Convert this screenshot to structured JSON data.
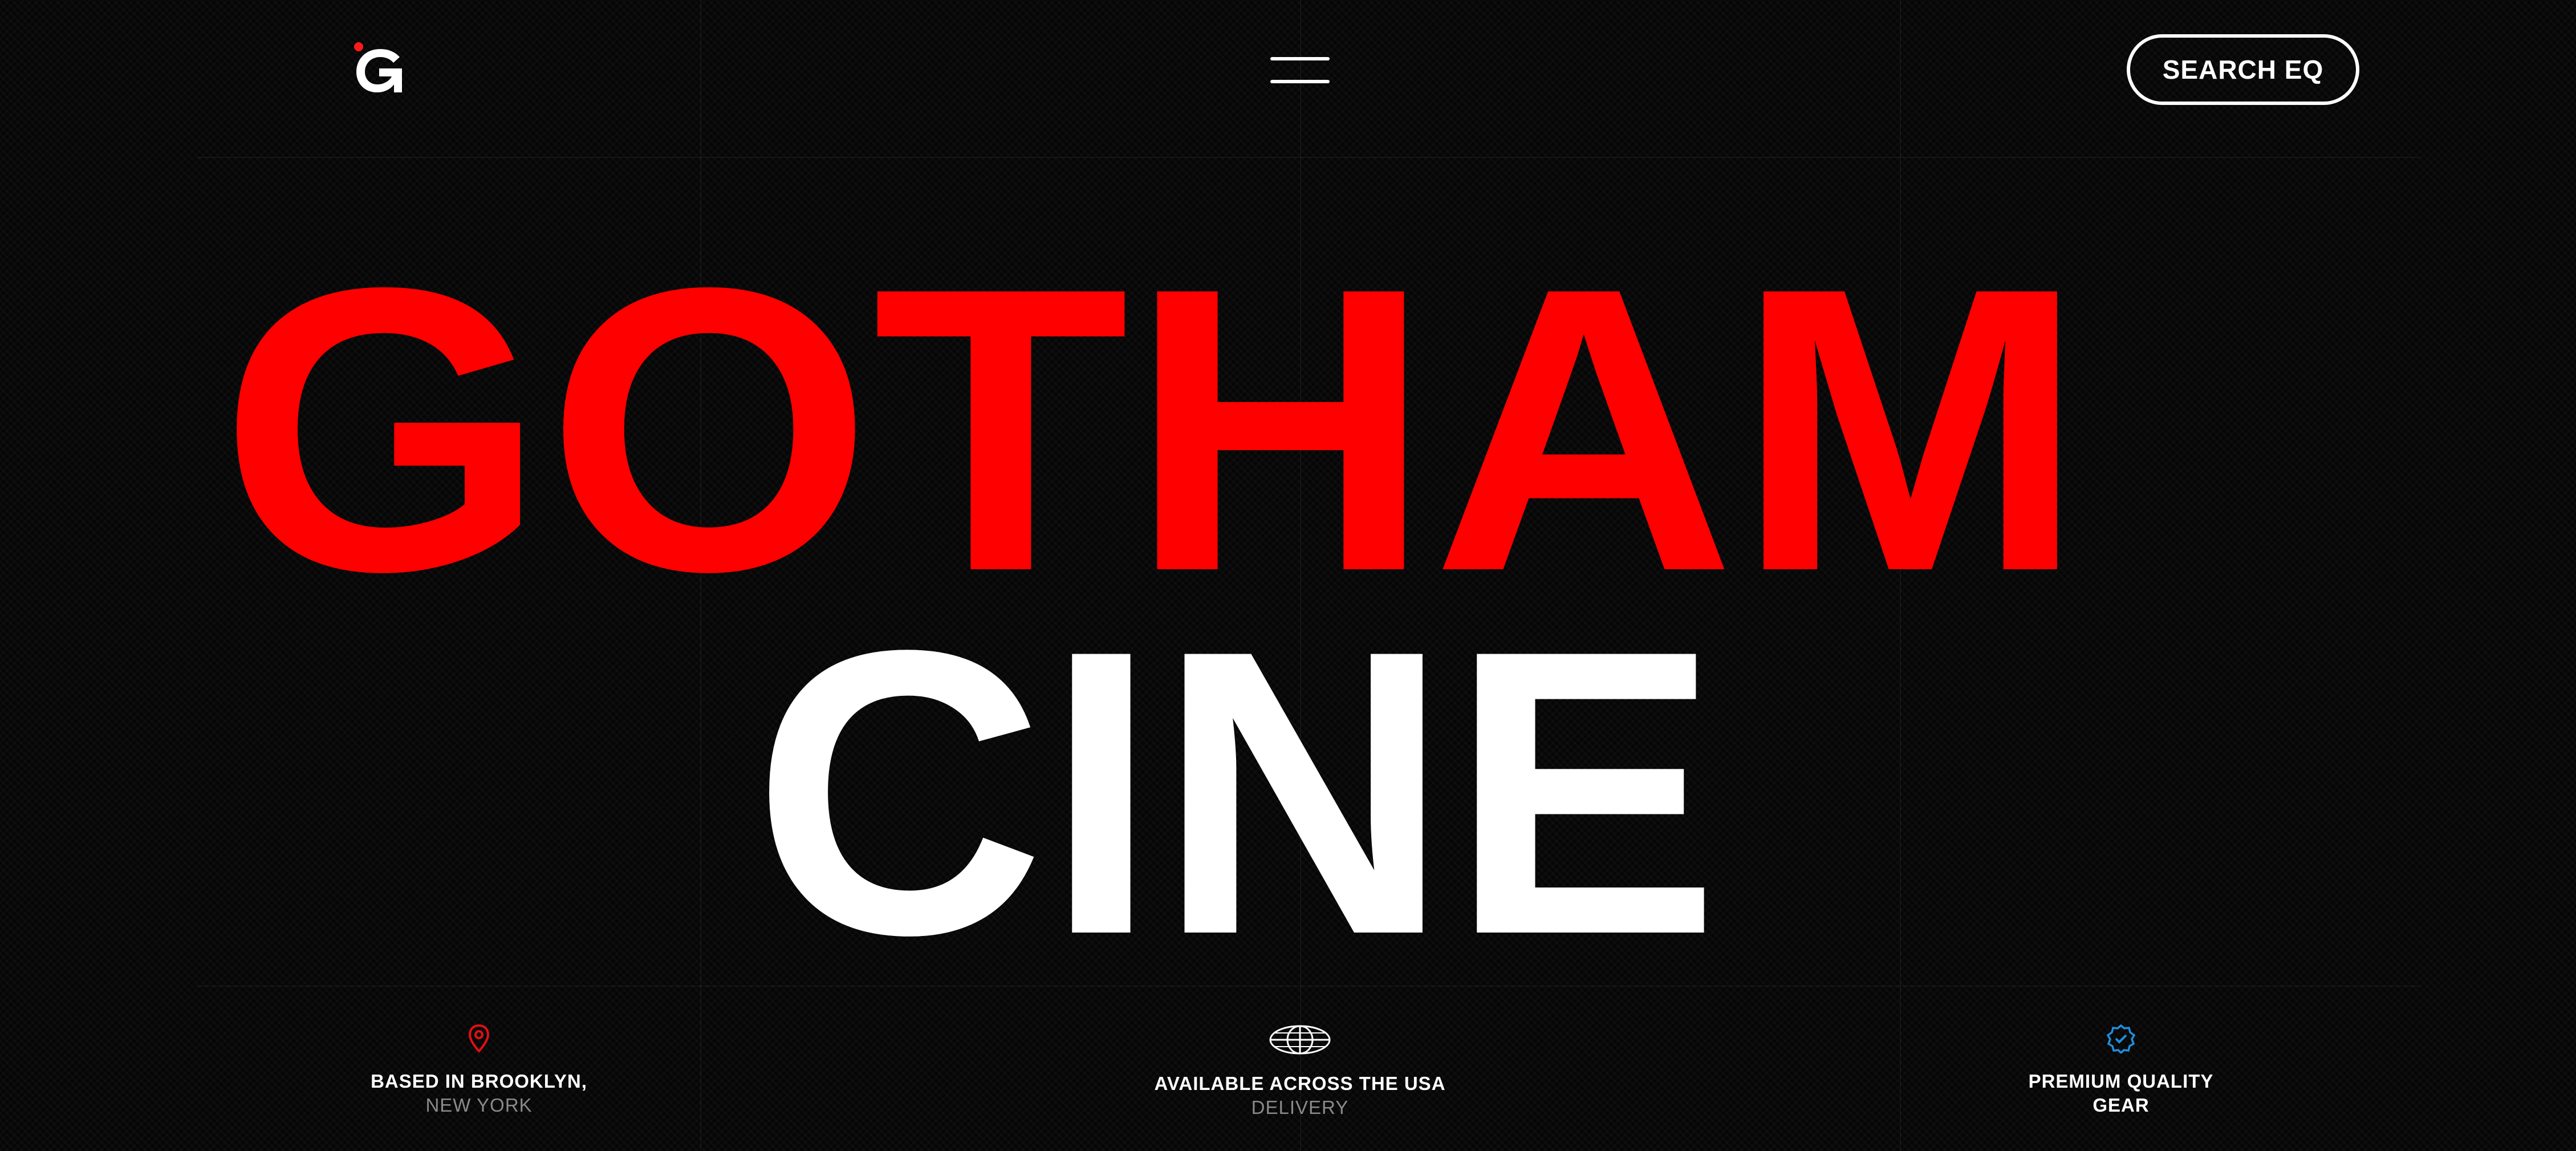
{
  "header": {
    "logo_icon": "gotham-g-logo-icon",
    "menu_icon": "hamburger-menu-icon",
    "search_label": "SEARCH EQ"
  },
  "hero": {
    "line1": "GOTHAM",
    "line2": "CINE",
    "line1_color": "#ff0000",
    "line2_color": "#ffffff"
  },
  "features": [
    {
      "icon": "location-pin-icon",
      "line1": "BASED IN BROOKLYN,",
      "line2": "NEW YORK",
      "icon_color": "#e01010"
    },
    {
      "icon": "globe-icon",
      "line1": "AVAILABLE ACROSS THE USA",
      "line2": "DELIVERY",
      "icon_color": "#ffffff"
    },
    {
      "icon": "verified-badge-icon",
      "line1": "PREMIUM QUALITY",
      "line2": "GEAR",
      "icon_color": "#1e8fe0"
    }
  ],
  "colors": {
    "background": "#060606",
    "accent": "#ff0000",
    "text": "#ffffff",
    "muted": "#8a8a8a"
  }
}
